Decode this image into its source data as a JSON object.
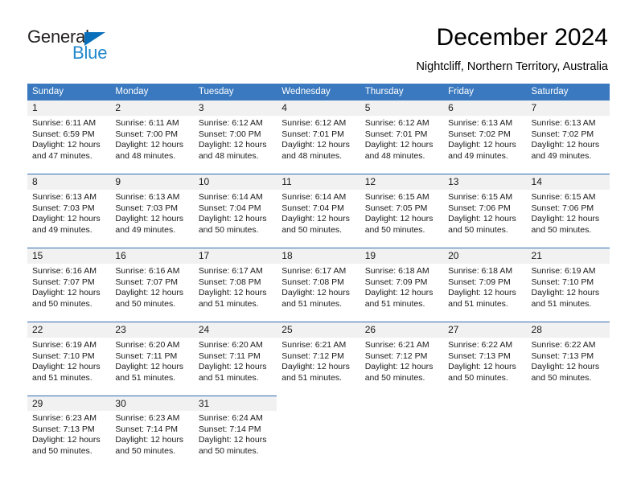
{
  "logo": {
    "word1": "General",
    "word2": "Blue",
    "triangle_color": "#0a6fba",
    "word2_color": "#2288cc"
  },
  "header": {
    "title": "December 2024",
    "subtitle": "Nightcliff, Northern Territory, Australia"
  },
  "theme": {
    "header_blue": "#3a79bf",
    "rule_blue": "#2f6daf",
    "daynum_bg": "#f1f1f1"
  },
  "weekdays": [
    "Sunday",
    "Monday",
    "Tuesday",
    "Wednesday",
    "Thursday",
    "Friday",
    "Saturday"
  ],
  "weeks": [
    {
      "days": [
        {
          "num": "1",
          "sunrise": "Sunrise: 6:11 AM",
          "sunset": "Sunset: 6:59 PM",
          "daylight1": "Daylight: 12 hours",
          "daylight2": "and 47 minutes."
        },
        {
          "num": "2",
          "sunrise": "Sunrise: 6:11 AM",
          "sunset": "Sunset: 7:00 PM",
          "daylight1": "Daylight: 12 hours",
          "daylight2": "and 48 minutes."
        },
        {
          "num": "3",
          "sunrise": "Sunrise: 6:12 AM",
          "sunset": "Sunset: 7:00 PM",
          "daylight1": "Daylight: 12 hours",
          "daylight2": "and 48 minutes."
        },
        {
          "num": "4",
          "sunrise": "Sunrise: 6:12 AM",
          "sunset": "Sunset: 7:01 PM",
          "daylight1": "Daylight: 12 hours",
          "daylight2": "and 48 minutes."
        },
        {
          "num": "5",
          "sunrise": "Sunrise: 6:12 AM",
          "sunset": "Sunset: 7:01 PM",
          "daylight1": "Daylight: 12 hours",
          "daylight2": "and 48 minutes."
        },
        {
          "num": "6",
          "sunrise": "Sunrise: 6:13 AM",
          "sunset": "Sunset: 7:02 PM",
          "daylight1": "Daylight: 12 hours",
          "daylight2": "and 49 minutes."
        },
        {
          "num": "7",
          "sunrise": "Sunrise: 6:13 AM",
          "sunset": "Sunset: 7:02 PM",
          "daylight1": "Daylight: 12 hours",
          "daylight2": "and 49 minutes."
        }
      ]
    },
    {
      "days": [
        {
          "num": "8",
          "sunrise": "Sunrise: 6:13 AM",
          "sunset": "Sunset: 7:03 PM",
          "daylight1": "Daylight: 12 hours",
          "daylight2": "and 49 minutes."
        },
        {
          "num": "9",
          "sunrise": "Sunrise: 6:13 AM",
          "sunset": "Sunset: 7:03 PM",
          "daylight1": "Daylight: 12 hours",
          "daylight2": "and 49 minutes."
        },
        {
          "num": "10",
          "sunrise": "Sunrise: 6:14 AM",
          "sunset": "Sunset: 7:04 PM",
          "daylight1": "Daylight: 12 hours",
          "daylight2": "and 50 minutes."
        },
        {
          "num": "11",
          "sunrise": "Sunrise: 6:14 AM",
          "sunset": "Sunset: 7:04 PM",
          "daylight1": "Daylight: 12 hours",
          "daylight2": "and 50 minutes."
        },
        {
          "num": "12",
          "sunrise": "Sunrise: 6:15 AM",
          "sunset": "Sunset: 7:05 PM",
          "daylight1": "Daylight: 12 hours",
          "daylight2": "and 50 minutes."
        },
        {
          "num": "13",
          "sunrise": "Sunrise: 6:15 AM",
          "sunset": "Sunset: 7:06 PM",
          "daylight1": "Daylight: 12 hours",
          "daylight2": "and 50 minutes."
        },
        {
          "num": "14",
          "sunrise": "Sunrise: 6:15 AM",
          "sunset": "Sunset: 7:06 PM",
          "daylight1": "Daylight: 12 hours",
          "daylight2": "and 50 minutes."
        }
      ]
    },
    {
      "days": [
        {
          "num": "15",
          "sunrise": "Sunrise: 6:16 AM",
          "sunset": "Sunset: 7:07 PM",
          "daylight1": "Daylight: 12 hours",
          "daylight2": "and 50 minutes."
        },
        {
          "num": "16",
          "sunrise": "Sunrise: 6:16 AM",
          "sunset": "Sunset: 7:07 PM",
          "daylight1": "Daylight: 12 hours",
          "daylight2": "and 50 minutes."
        },
        {
          "num": "17",
          "sunrise": "Sunrise: 6:17 AM",
          "sunset": "Sunset: 7:08 PM",
          "daylight1": "Daylight: 12 hours",
          "daylight2": "and 51 minutes."
        },
        {
          "num": "18",
          "sunrise": "Sunrise: 6:17 AM",
          "sunset": "Sunset: 7:08 PM",
          "daylight1": "Daylight: 12 hours",
          "daylight2": "and 51 minutes."
        },
        {
          "num": "19",
          "sunrise": "Sunrise: 6:18 AM",
          "sunset": "Sunset: 7:09 PM",
          "daylight1": "Daylight: 12 hours",
          "daylight2": "and 51 minutes."
        },
        {
          "num": "20",
          "sunrise": "Sunrise: 6:18 AM",
          "sunset": "Sunset: 7:09 PM",
          "daylight1": "Daylight: 12 hours",
          "daylight2": "and 51 minutes."
        },
        {
          "num": "21",
          "sunrise": "Sunrise: 6:19 AM",
          "sunset": "Sunset: 7:10 PM",
          "daylight1": "Daylight: 12 hours",
          "daylight2": "and 51 minutes."
        }
      ]
    },
    {
      "days": [
        {
          "num": "22",
          "sunrise": "Sunrise: 6:19 AM",
          "sunset": "Sunset: 7:10 PM",
          "daylight1": "Daylight: 12 hours",
          "daylight2": "and 51 minutes."
        },
        {
          "num": "23",
          "sunrise": "Sunrise: 6:20 AM",
          "sunset": "Sunset: 7:11 PM",
          "daylight1": "Daylight: 12 hours",
          "daylight2": "and 51 minutes."
        },
        {
          "num": "24",
          "sunrise": "Sunrise: 6:20 AM",
          "sunset": "Sunset: 7:11 PM",
          "daylight1": "Daylight: 12 hours",
          "daylight2": "and 51 minutes."
        },
        {
          "num": "25",
          "sunrise": "Sunrise: 6:21 AM",
          "sunset": "Sunset: 7:12 PM",
          "daylight1": "Daylight: 12 hours",
          "daylight2": "and 51 minutes."
        },
        {
          "num": "26",
          "sunrise": "Sunrise: 6:21 AM",
          "sunset": "Sunset: 7:12 PM",
          "daylight1": "Daylight: 12 hours",
          "daylight2": "and 50 minutes."
        },
        {
          "num": "27",
          "sunrise": "Sunrise: 6:22 AM",
          "sunset": "Sunset: 7:13 PM",
          "daylight1": "Daylight: 12 hours",
          "daylight2": "and 50 minutes."
        },
        {
          "num": "28",
          "sunrise": "Sunrise: 6:22 AM",
          "sunset": "Sunset: 7:13 PM",
          "daylight1": "Daylight: 12 hours",
          "daylight2": "and 50 minutes."
        }
      ]
    },
    {
      "days": [
        {
          "num": "29",
          "sunrise": "Sunrise: 6:23 AM",
          "sunset": "Sunset: 7:13 PM",
          "daylight1": "Daylight: 12 hours",
          "daylight2": "and 50 minutes."
        },
        {
          "num": "30",
          "sunrise": "Sunrise: 6:23 AM",
          "sunset": "Sunset: 7:14 PM",
          "daylight1": "Daylight: 12 hours",
          "daylight2": "and 50 minutes."
        },
        {
          "num": "31",
          "sunrise": "Sunrise: 6:24 AM",
          "sunset": "Sunset: 7:14 PM",
          "daylight1": "Daylight: 12 hours",
          "daylight2": "and 50 minutes."
        },
        {
          "num": "",
          "sunrise": "",
          "sunset": "",
          "daylight1": "",
          "daylight2": ""
        },
        {
          "num": "",
          "sunrise": "",
          "sunset": "",
          "daylight1": "",
          "daylight2": ""
        },
        {
          "num": "",
          "sunrise": "",
          "sunset": "",
          "daylight1": "",
          "daylight2": ""
        },
        {
          "num": "",
          "sunrise": "",
          "sunset": "",
          "daylight1": "",
          "daylight2": ""
        }
      ]
    }
  ]
}
